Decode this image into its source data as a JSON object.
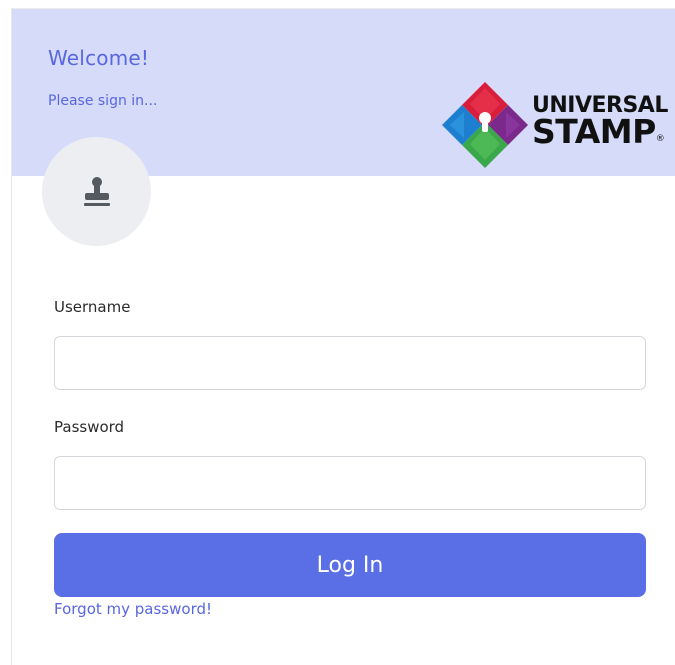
{
  "header": {
    "title": "Welcome!",
    "subtitle": "Please sign in...",
    "logo_line1": "UNIVERSAL",
    "logo_line2": "STAMP",
    "logo_mark": "®"
  },
  "avatar": {
    "icon": "stamp-icon"
  },
  "form": {
    "username_label": "Username",
    "username_value": "",
    "password_label": "Password",
    "password_value": "",
    "login_label": "Log In",
    "forgot_label": "Forgot my password!"
  },
  "colors": {
    "header_bg": "#d5dbf8",
    "accent": "#5867e0",
    "button_bg": "#5a6ee6"
  }
}
